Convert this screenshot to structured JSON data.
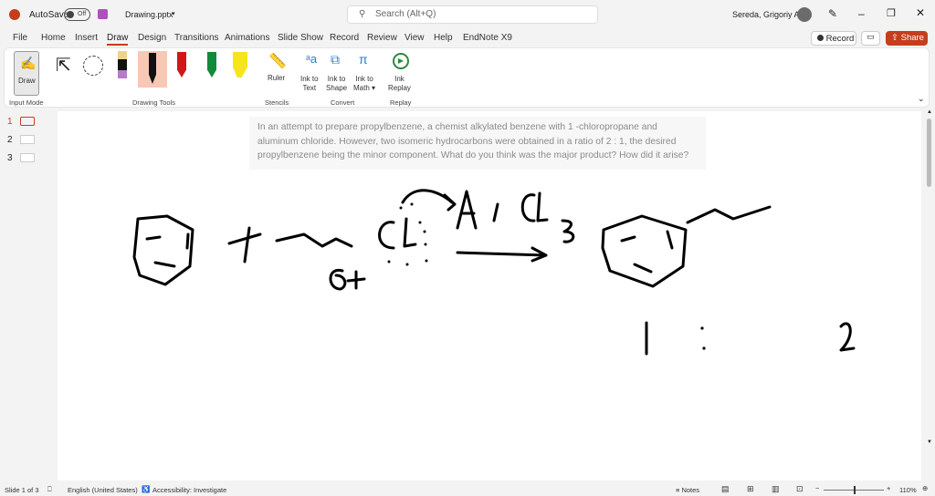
{
  "titlebar": {
    "autosave": "AutoSave",
    "toggle": "Off",
    "filename": "Drawing.pptx",
    "search_placeholder": "Search (Alt+Q)",
    "user": "Sereda, Grigoriy A"
  },
  "menu": [
    "File",
    "Home",
    "Insert",
    "Draw",
    "Design",
    "Transitions",
    "Animations",
    "Slide Show",
    "Record",
    "Review",
    "View",
    "Help",
    "EndNote X9"
  ],
  "actions": {
    "record": "Record",
    "share": "Share"
  },
  "ribbon": {
    "draw": "Draw",
    "input_mode": "Input Mode",
    "drawing_tools": "Drawing Tools",
    "ruler": "Ruler",
    "stencils": "Stencils",
    "ink_to_text": [
      "Ink to",
      "Text"
    ],
    "ink_to_shape": [
      "Ink to",
      "Shape"
    ],
    "ink_to_math": [
      "Ink to",
      "Math"
    ],
    "convert": "Convert",
    "ink_replay": [
      "Ink",
      "Replay"
    ],
    "replay": "Replay"
  },
  "thumbnails": [
    "1",
    "2",
    "3"
  ],
  "slide": {
    "question": "In an attempt to prepare propylbenzene, a chemist alkylated benzene with 1 -chloropropane and aluminum chloride. However, two isomeric hydrocarbons were obtained in a ratio of 2 : 1, the desired propylbenzene being the minor component. What do you think was the major product? How did it arise?"
  },
  "status": {
    "slide": "Slide 1 of 3",
    "language": "English (United States)",
    "accessibility": "Accessibility: Investigate",
    "notes": "Notes",
    "zoom": "110%"
  },
  "colors": {
    "accent": "#c43e1c",
    "share": "#c43e1c"
  }
}
